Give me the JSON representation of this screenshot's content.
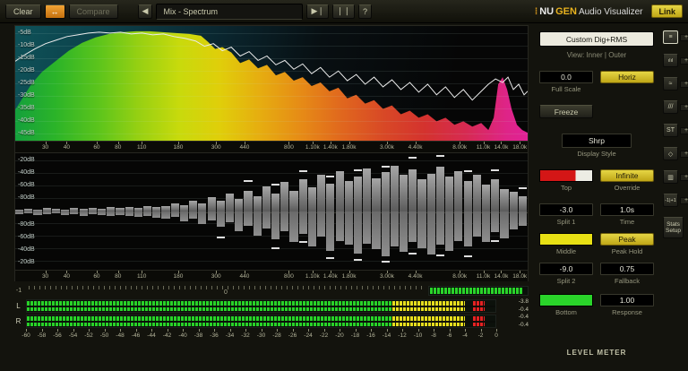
{
  "header": {
    "clear": "Clear",
    "swap_icon": "↔",
    "compare": "Compare",
    "prev_icon": "◀",
    "preset": "Mix - Spectrum",
    "play_icon": "▶❘",
    "pause_icon": "❘❘",
    "help": "?",
    "brand_dots": "⁞",
    "brand_nu": "NU",
    "brand_gen": "GEN",
    "brand_rest": " Audio Visualizer",
    "link": "Link"
  },
  "spectrum": {
    "db_labels": [
      "-5dB",
      "-10dB",
      "-15dB",
      "-20dB",
      "-25dB",
      "-30dB",
      "-35dB",
      "-40dB",
      "-45dB"
    ],
    "fill_points": [
      [
        0,
        95
      ],
      [
        8,
        82
      ],
      [
        18,
        66
      ],
      [
        30,
        52
      ],
      [
        45,
        40
      ],
      [
        60,
        28
      ],
      [
        75,
        19
      ],
      [
        90,
        13
      ],
      [
        105,
        9
      ],
      [
        120,
        7
      ],
      [
        135,
        6
      ],
      [
        150,
        6
      ],
      [
        165,
        7
      ],
      [
        180,
        8
      ],
      [
        195,
        9
      ],
      [
        208,
        11
      ],
      [
        216,
        18
      ],
      [
        224,
        26
      ],
      [
        232,
        24
      ],
      [
        242,
        30
      ],
      [
        252,
        42
      ],
      [
        262,
        38
      ],
      [
        272,
        48
      ],
      [
        282,
        44
      ],
      [
        292,
        56
      ],
      [
        302,
        52
      ],
      [
        312,
        62
      ],
      [
        322,
        58
      ],
      [
        332,
        68
      ],
      [
        342,
        64
      ],
      [
        352,
        74
      ],
      [
        362,
        70
      ],
      [
        372,
        82
      ],
      [
        382,
        78
      ],
      [
        392,
        88
      ],
      [
        402,
        84
      ],
      [
        412,
        94
      ],
      [
        422,
        90
      ],
      [
        432,
        100
      ],
      [
        442,
        96
      ],
      [
        452,
        104
      ],
      [
        462,
        100
      ],
      [
        472,
        108
      ],
      [
        482,
        104
      ],
      [
        492,
        112
      ],
      [
        502,
        108
      ],
      [
        512,
        114
      ],
      [
        522,
        110
      ],
      [
        530,
        118
      ],
      [
        536,
        104
      ],
      [
        541,
        66
      ],
      [
        546,
        58
      ],
      [
        551,
        72
      ],
      [
        556,
        94
      ],
      [
        562,
        112
      ],
      [
        568,
        118
      ],
      [
        574,
        121
      ]
    ],
    "line_points": [
      [
        0,
        40
      ],
      [
        10,
        33
      ],
      [
        22,
        26
      ],
      [
        34,
        20
      ],
      [
        46,
        16
      ],
      [
        58,
        12
      ],
      [
        70,
        10
      ],
      [
        82,
        8
      ],
      [
        94,
        7
      ],
      [
        106,
        8
      ],
      [
        118,
        7
      ],
      [
        130,
        9
      ],
      [
        142,
        8
      ],
      [
        154,
        10
      ],
      [
        166,
        9
      ],
      [
        178,
        12
      ],
      [
        190,
        14
      ],
      [
        202,
        17
      ],
      [
        212,
        23
      ],
      [
        222,
        20
      ],
      [
        232,
        28
      ],
      [
        242,
        24
      ],
      [
        252,
        34
      ],
      [
        262,
        29
      ],
      [
        272,
        39
      ],
      [
        282,
        34
      ],
      [
        292,
        44
      ],
      [
        302,
        39
      ],
      [
        312,
        49
      ],
      [
        322,
        43
      ],
      [
        332,
        54
      ],
      [
        342,
        47
      ],
      [
        352,
        58
      ],
      [
        362,
        51
      ],
      [
        372,
        62
      ],
      [
        382,
        55
      ],
      [
        392,
        66
      ],
      [
        402,
        58
      ],
      [
        412,
        69
      ],
      [
        422,
        61
      ],
      [
        432,
        72
      ],
      [
        442,
        64
      ],
      [
        452,
        75
      ],
      [
        462,
        66
      ],
      [
        472,
        78
      ],
      [
        482,
        69
      ],
      [
        492,
        81
      ],
      [
        502,
        72
      ],
      [
        512,
        84
      ],
      [
        522,
        74
      ],
      [
        530,
        66
      ],
      [
        538,
        60
      ],
      [
        546,
        64
      ],
      [
        552,
        58
      ],
      [
        558,
        72
      ],
      [
        564,
        66
      ],
      [
        570,
        78
      ],
      [
        574,
        74
      ]
    ]
  },
  "freq_labels": [
    "30",
    "40",
    "60",
    "80",
    "110",
    "180",
    "300",
    "440",
    "800",
    "1.10k",
    "1.40k",
    "1.80k",
    "3.00k",
    "4.40k",
    "8.00k",
    "11.0k",
    "14.0k",
    "18.0k"
  ],
  "freq_values": [
    30,
    40,
    60,
    80,
    110,
    180,
    300,
    440,
    800,
    1100,
    1400,
    1800,
    3000,
    4400,
    8000,
    11000,
    14000,
    18000
  ],
  "mid_meter": {
    "db_labels_top": [
      "-20dB",
      "-40dB",
      "-60dB",
      "-80dB"
    ],
    "db_labels_bottom": [
      "-80dB",
      "-60dB",
      "-40dB",
      "-20dB"
    ],
    "bars_up": [
      0.03,
      0.04,
      0.03,
      0.05,
      0.04,
      0.03,
      0.05,
      0.04,
      0.05,
      0.04,
      0.06,
      0.05,
      0.07,
      0.05,
      0.08,
      0.06,
      0.08,
      0.12,
      0.09,
      0.16,
      0.12,
      0.2,
      0.15,
      0.26,
      0.18,
      0.3,
      0.22,
      0.36,
      0.26,
      0.42,
      0.3,
      0.46,
      0.34,
      0.52,
      0.4,
      0.58,
      0.44,
      0.5,
      0.62,
      0.48,
      0.56,
      0.66,
      0.52,
      0.6,
      0.46,
      0.54,
      0.64,
      0.5,
      0.58,
      0.44,
      0.52,
      0.38,
      0.46,
      0.32,
      0.28,
      0.22
    ],
    "bars_down": [
      0.04,
      0.03,
      0.05,
      0.04,
      0.03,
      0.05,
      0.04,
      0.06,
      0.04,
      0.05,
      0.07,
      0.05,
      0.06,
      0.08,
      0.06,
      0.09,
      0.1,
      0.08,
      0.14,
      0.1,
      0.18,
      0.13,
      0.22,
      0.16,
      0.28,
      0.2,
      0.34,
      0.24,
      0.4,
      0.28,
      0.44,
      0.32,
      0.5,
      0.36,
      0.56,
      0.42,
      0.48,
      0.6,
      0.46,
      0.54,
      0.64,
      0.5,
      0.58,
      0.44,
      0.52,
      0.62,
      0.48,
      0.56,
      0.42,
      0.5,
      0.36,
      0.44,
      0.3,
      0.38,
      0.26,
      0.2
    ]
  },
  "correlation": {
    "left_label": "-1",
    "center_label": "0",
    "bar_fill": 0.94
  },
  "level_meter": {
    "channels": [
      "L",
      "R"
    ],
    "readouts": [
      [
        "-3.8",
        "-0.4"
      ],
      [
        "-0.4",
        "-0.4"
      ]
    ],
    "zones": {
      "green": [
        0,
        0.78
      ],
      "yellow": [
        0.78,
        0.935
      ],
      "red": [
        0.952,
        0.978
      ]
    },
    "scale": [
      "-60",
      "-58",
      "-56",
      "-54",
      "-52",
      "-50",
      "-48",
      "-46",
      "-44",
      "-42",
      "-40",
      "-38",
      "-36",
      "-34",
      "-32",
      "-30",
      "-28",
      "-26",
      "-24",
      "-22",
      "-20",
      "-18",
      "-16",
      "-14",
      "-12",
      "-10",
      "-8",
      "-6",
      "-4",
      "-2",
      "0"
    ]
  },
  "side_panel": {
    "preset": "Custom Dig+RMS",
    "view_label": "View: Inner | Outer",
    "full_scale_value": "0.0",
    "full_scale_label": "Full Scale",
    "horiz_btn": "Horiz",
    "freeze_btn": "Freeze",
    "display_style_value": "Shrp",
    "display_style_label": "Display Style",
    "top_label": "Top",
    "override_btn": "Infinite",
    "override_label": "Override",
    "split1_value": "-3.0",
    "split1_label": "Split 1",
    "time_value": "1.0s",
    "time_label": "Time",
    "middle_label": "Middle",
    "peak_btn": "Peak",
    "peak_label": "Peak Hold",
    "split2_value": "-9.0",
    "split2_label": "Split 2",
    "fallback_value": "0.75",
    "fallback_label": "Fallback",
    "bottom_label": "Bottom",
    "response_value": "1.00",
    "response_label": "Response",
    "level_meter_label": "LEVEL METER"
  },
  "mode_strip": {
    "plus": "+",
    "stats_line1": "Stats",
    "stats_line2": "Setup",
    "items": [
      {
        "name": "view-mode-spectrum",
        "glyph": "≡",
        "selected": true
      },
      {
        "name": "view-mode-bars",
        "glyph": "ılıl",
        "selected": false
      },
      {
        "name": "view-mode-wave",
        "glyph": "≈",
        "selected": false
      },
      {
        "name": "view-mode-hatch",
        "glyph": "///",
        "selected": false
      },
      {
        "name": "view-mode-stereo",
        "glyph": "ST",
        "selected": false
      },
      {
        "name": "view-mode-vectorscope",
        "glyph": "◇",
        "selected": false
      },
      {
        "name": "view-mode-meter",
        "glyph": "▥",
        "selected": false
      },
      {
        "name": "view-mode-offset",
        "glyph": "-1|+1",
        "selected": false
      }
    ]
  },
  "colors": {
    "accent_yellow": "#d9c832",
    "accent_orange": "#e08a20",
    "meter_green": "#28d228",
    "meter_yellow": "#e6de1e",
    "meter_red": "#e62222",
    "panel_bg": "#13130d"
  }
}
